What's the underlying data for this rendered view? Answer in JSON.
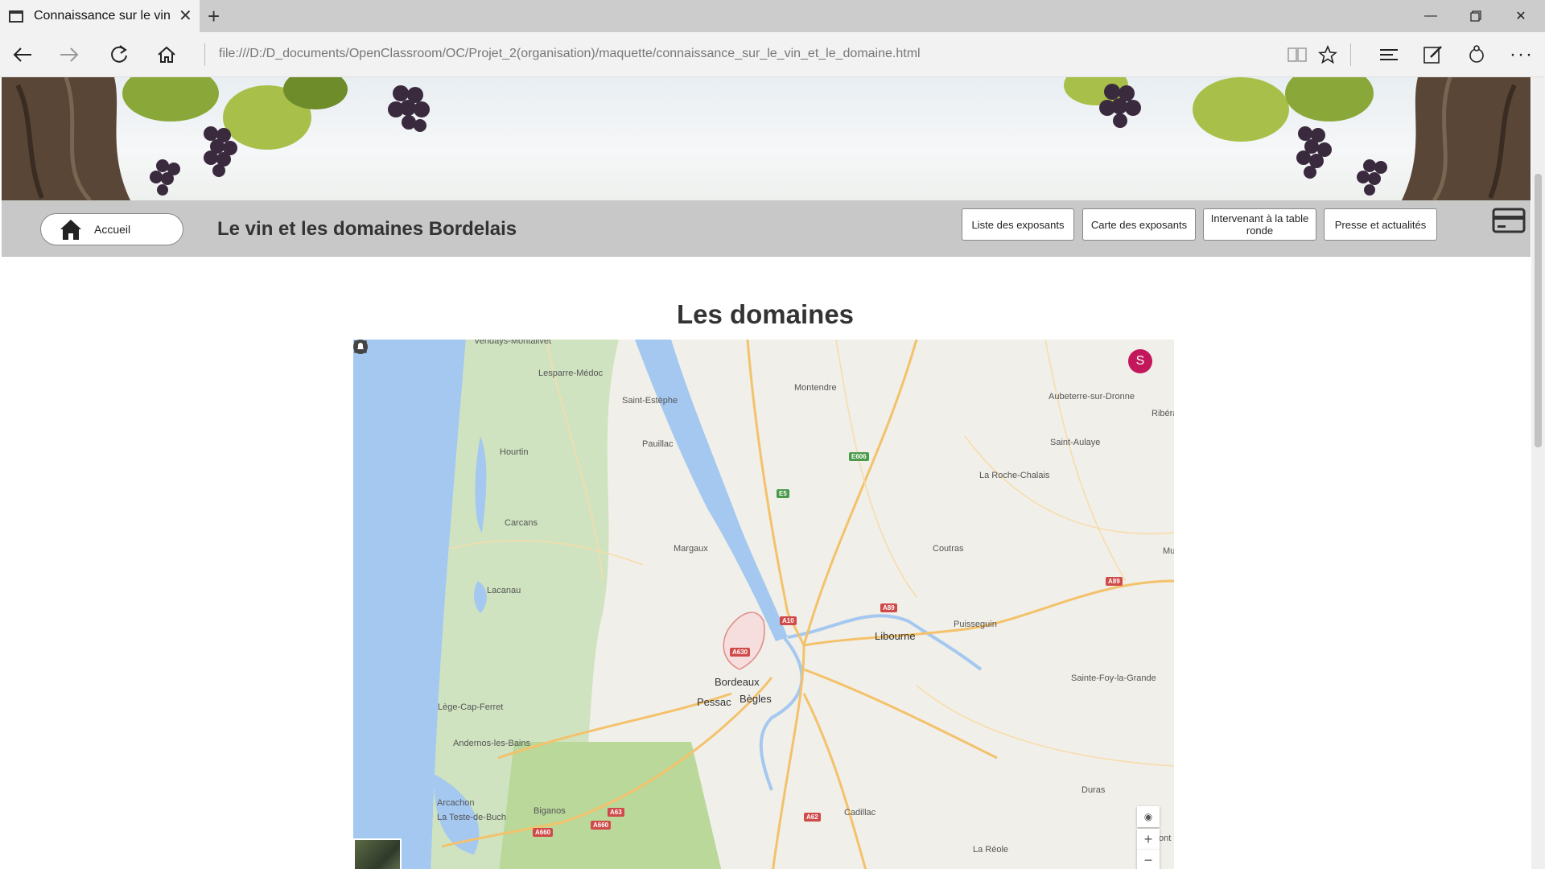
{
  "browser": {
    "tab_title": "Connaissance sur le vin",
    "url": "file:///D:/D_documents/OpenClassroom/OC/Projet_2(organisation)/maquette/connaissance_sur_le_vin_et_le_domaine.html"
  },
  "header": {
    "home_label": "Accueil",
    "site_title": "Le vin et les domaines Bordelais",
    "menu": [
      {
        "label": "Liste des exposants"
      },
      {
        "label": "Carte des exposants"
      },
      {
        "label": "Intervenant à la table ronde"
      },
      {
        "label": "Presse et actualités"
      }
    ]
  },
  "main": {
    "section_title": "Les domaines",
    "map": {
      "avatar_initial": "S",
      "avatar_color": "#c2185b",
      "water_color": "#a4c8f0",
      "forest_color": "#cfe3c0",
      "road_color": "#f3c26b",
      "places": [
        {
          "name": "Vendays-Montalivet"
        },
        {
          "name": "Lesparre-Médoc"
        },
        {
          "name": "Saint-Estèphe"
        },
        {
          "name": "Montendre"
        },
        {
          "name": "Aubeterre-sur-Dronne"
        },
        {
          "name": "Ribéra"
        },
        {
          "name": "Hourtin"
        },
        {
          "name": "Pauillac"
        },
        {
          "name": "Saint-Aulaye"
        },
        {
          "name": "La Roche-Chalais"
        },
        {
          "name": "Carcans"
        },
        {
          "name": "Margaux"
        },
        {
          "name": "Coutras"
        },
        {
          "name": "Mu"
        },
        {
          "name": "Lacanau"
        },
        {
          "name": "Puisseguin"
        },
        {
          "name": "Libourne"
        },
        {
          "name": "Bordeaux"
        },
        {
          "name": "Pessac"
        },
        {
          "name": "Bègles"
        },
        {
          "name": "Sainte-Foy-la-Grande"
        },
        {
          "name": "Lège-Cap-Ferret"
        },
        {
          "name": "Andernos-les-Bains"
        },
        {
          "name": "Arcachon"
        },
        {
          "name": "La Teste-de-Buch"
        },
        {
          "name": "Biganos"
        },
        {
          "name": "Duras"
        },
        {
          "name": "Cadillac"
        },
        {
          "name": "La Réole"
        },
        {
          "name": "ont"
        }
      ],
      "shields": [
        {
          "label": "E606"
        },
        {
          "label": "E5"
        },
        {
          "label": "A10"
        },
        {
          "label": "A89"
        },
        {
          "label": "A89"
        },
        {
          "label": "A630"
        },
        {
          "label": "A63"
        },
        {
          "label": "A660"
        },
        {
          "label": "A660"
        },
        {
          "label": "A62"
        }
      ],
      "zoom_in": "+",
      "zoom_out": "−"
    }
  }
}
